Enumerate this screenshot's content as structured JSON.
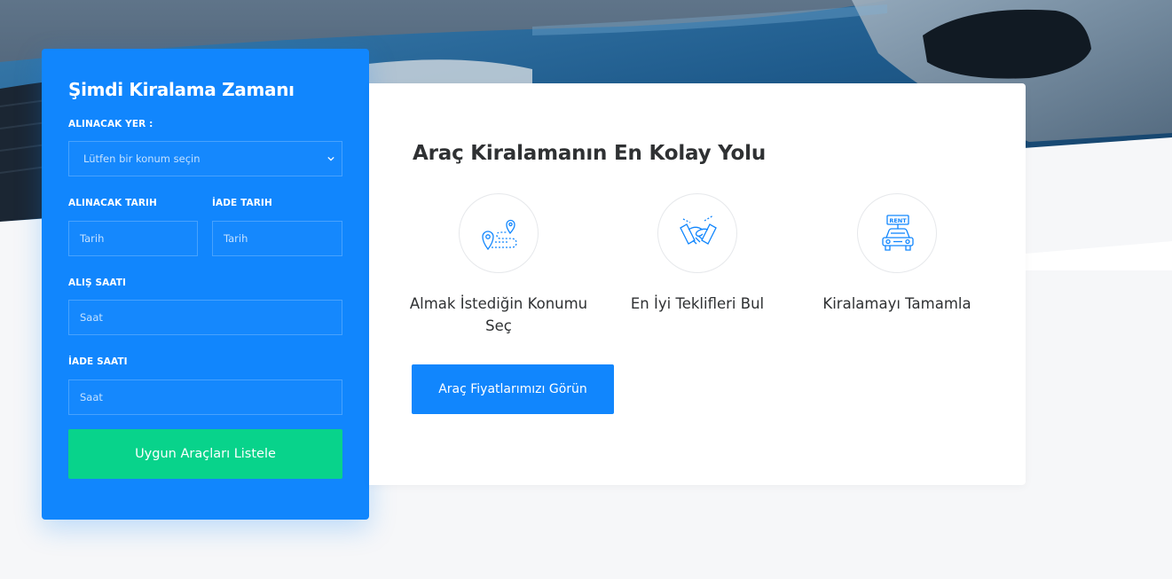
{
  "booking": {
    "title": "Şimdi Kiralama Zamanı",
    "pickup_location_label": "ALINACAK YER :",
    "pickup_location_value": "Lütfen bir konum seçin",
    "pickup_date_label": "ALINACAK TARIH",
    "pickup_date_placeholder": "Tarih",
    "return_date_label": "İADE TARIH",
    "return_date_placeholder": "Tarih",
    "pickup_time_label": "ALIŞ SAATI",
    "pickup_time_placeholder": "Saat",
    "return_time_label": "İADE SAATI",
    "return_time_placeholder": "Saat",
    "submit_label": "Uygun Araçları Listele"
  },
  "info": {
    "title": "Araç Kiralamanın En Kolay Yolu",
    "steps": [
      {
        "icon": "location-route-icon",
        "label": "Almak İstediğin Konumu Seç"
      },
      {
        "icon": "handshake-icon",
        "label": "En İyi Teklifleri Bul"
      },
      {
        "icon": "rent-car-icon",
        "label": "Kiralamayı Tamamla"
      }
    ],
    "cta_label": "Araç Fiyatlarımızı Görün"
  },
  "colors": {
    "primary": "#1186fd",
    "success": "#08d38b",
    "page_bg": "#f6f7f9",
    "text": "#2f3133"
  }
}
